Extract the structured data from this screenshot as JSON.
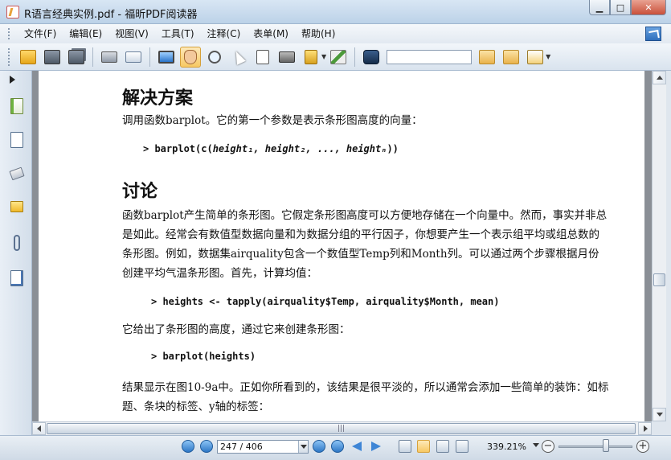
{
  "window": {
    "title": "R语言经典实例.pdf - 福昕PDF阅读器",
    "buttons": {
      "minimize": "▁",
      "maximize": "□",
      "close": "✕"
    }
  },
  "menu": {
    "items": [
      "文件(F)",
      "编辑(E)",
      "视图(V)",
      "工具(T)",
      "注释(C)",
      "表单(M)",
      "帮助(H)"
    ]
  },
  "toolbar": {
    "buttons": [
      "folder-icon",
      "save-icon",
      "save-all-icon",
      "printer-icon",
      "properties-icon",
      "fullscreen-icon",
      "hand-icon",
      "zoom-icon",
      "select-icon",
      "text-select-icon",
      "snapshot-icon",
      "security-icon",
      "typewriter-icon",
      "find-icon",
      "find-prev-icon",
      "find-next-icon",
      "highlight-icon"
    ],
    "security_badge": "RMS",
    "search_value": ""
  },
  "document": {
    "heading_solution": "解决方案",
    "para_solution": "调用函数barplot。它的第一个参数是表示条形图高度的向量：",
    "code1_prefix": "> barplot(c(",
    "code1_args": "height₁, height₂, ..., heightₙ",
    "code1_suffix": "))",
    "heading_discussion": "讨论",
    "para_discussion": "函数barplot产生简单的条形图。它假定条形图高度可以方便地存储在一个向量中。然而，事实并非总是如此。经常会有数值型数据向量和为数据分组的平行因子，你想要产生一个表示组平均或组总数的条形图。例如，数据集airquality包含一个数值型Temp列和Month列。可以通过两个步骤根据月份创建平均气温条形图。首先，计算均值：",
    "code2": "> heights <- tapply(airquality$Temp, airquality$Month, mean)",
    "para_heights": "它给出了条形图的高度，通过它来创建条形图：",
    "code3": "> barplot(heights)",
    "para_result": "结果显示在图10-9a中。正如你所看到的，该结果是很平淡的，所以通常会添加一些简单的装饰：如标题、条块的标签、y轴的标签："
  },
  "statusbar": {
    "page_value": "247 / 406",
    "zoom_value": "339.21%",
    "zoom_level_fraction": 0.62
  }
}
